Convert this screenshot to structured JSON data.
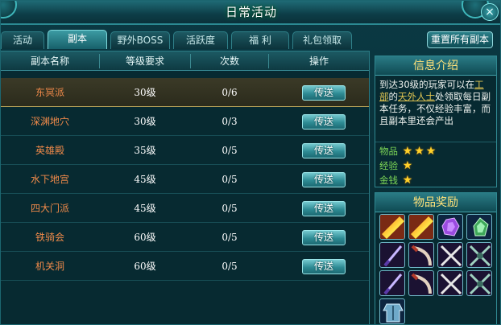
{
  "window": {
    "title": "日常活动"
  },
  "tabs": [
    {
      "label": "活动",
      "active": false
    },
    {
      "label": "副本",
      "active": true
    },
    {
      "label": "野外BOSS",
      "active": false
    },
    {
      "label": "活跃度",
      "active": false
    },
    {
      "label": "福 利",
      "active": false
    },
    {
      "label": "礼包领取",
      "active": false
    }
  ],
  "reset_button": "重置所有副本",
  "table": {
    "headers": [
      "副本名称",
      "等级要求",
      "次数",
      "操作"
    ],
    "rows": [
      {
        "name": "东冥派",
        "level": "30级",
        "count": "0/6",
        "action": "传送",
        "selected": true
      },
      {
        "name": "深渊地穴",
        "level": "30级",
        "count": "0/3",
        "action": "传送"
      },
      {
        "name": "英雄殿",
        "level": "35级",
        "count": "0/5",
        "action": "传送"
      },
      {
        "name": "水下地宫",
        "level": "45级",
        "count": "0/5",
        "action": "传送"
      },
      {
        "name": "四大门派",
        "level": "45级",
        "count": "0/5",
        "action": "传送"
      },
      {
        "name": "铁骑会",
        "level": "60级",
        "count": "0/5",
        "action": "传送"
      },
      {
        "name": "机关洞",
        "level": "60级",
        "count": "0/5",
        "action": "传送"
      }
    ]
  },
  "info": {
    "title": "信息介绍",
    "text_1": "到达30级的玩家可以在",
    "link_1": "工部",
    "text_2": "的",
    "link_2": "天外人士",
    "text_3": "处领取每日副本任务，不仅经验丰富，而且副本里还会产出",
    "ratings": [
      {
        "label": "物品",
        "stars": 3
      },
      {
        "label": "经验",
        "stars": 1
      },
      {
        "label": "金钱",
        "stars": 1
      }
    ]
  },
  "rewards": {
    "title": "物品奖励",
    "items": [
      {
        "icon": "rainbow-scroll-icon"
      },
      {
        "icon": "rainbow-scroll-icon"
      },
      {
        "icon": "purple-gem-icon"
      },
      {
        "icon": "green-gem-icon"
      },
      {
        "icon": "dagger-icon"
      },
      {
        "icon": "curved-blade-icon"
      },
      {
        "icon": "crossed-swords-icon"
      },
      {
        "icon": "crossed-axes-icon"
      },
      {
        "icon": "dagger-icon"
      },
      {
        "icon": "curved-blade-icon"
      },
      {
        "icon": "crossed-swords-icon"
      },
      {
        "icon": "crossed-axes-icon"
      },
      {
        "icon": "armor-icon"
      }
    ]
  },
  "colors": {
    "accent": "#2f8a93",
    "dungeon_name": "#f08a4a",
    "star": "#ffd12a",
    "rating_label": "#7ed957"
  }
}
